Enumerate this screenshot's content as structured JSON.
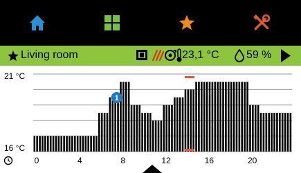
{
  "nav": {
    "items": [
      {
        "name": "home",
        "icon": "home-icon",
        "color": "#2a8fd4"
      },
      {
        "name": "grid",
        "icon": "grid-icon",
        "color": "#77c043"
      },
      {
        "name": "favorites",
        "icon": "star-icon",
        "color": "#f08a1f"
      },
      {
        "name": "settings",
        "icon": "tools-icon",
        "color": "#e35a2e"
      }
    ]
  },
  "status": {
    "room": "Living room",
    "temperature": "23,1 °C",
    "humidity": "59 %",
    "icons": [
      "window-icon",
      "heating-icon",
      "cycle-mode-icon",
      "thermometer-icon",
      "droplet-icon",
      "play-arrow-icon"
    ],
    "accent_color": "#8dc53e"
  },
  "chart_data": {
    "type": "bar",
    "y_top_label": "21 °C",
    "y_bottom_label": "16 °C",
    "ylim": [
      16,
      21
    ],
    "xlim": [
      0,
      24
    ],
    "x_ticks": [
      "0",
      "4",
      "8",
      "12",
      "16",
      "20"
    ],
    "x_tick_values": [
      0,
      4,
      8,
      12,
      16,
      20
    ],
    "marker_label": "1",
    "marker_hour": 8,
    "current_hour": 14.5,
    "bar_color": "#000000",
    "current_marker_color": "#e35a2e",
    "values": [
      17,
      17,
      17,
      17,
      17,
      17,
      17,
      17,
      17,
      17,
      17,
      17,
      17,
      17,
      17,
      17,
      17,
      17,
      17,
      17,
      17,
      17,
      17,
      17,
      18.5,
      18.5,
      18.5,
      18.5,
      19.5,
      19.5,
      19.5,
      19.5,
      20.5,
      20.5,
      20.5,
      20.5,
      19,
      19,
      19,
      19,
      18.5,
      18.5,
      18.5,
      18.5,
      18,
      18,
      18,
      18,
      19,
      19,
      19,
      19,
      19.5,
      19.5,
      19.5,
      19.5,
      20,
      20,
      20,
      20,
      20.5,
      20.5,
      20.5,
      20.5,
      20.5,
      20.5,
      20.5,
      20.5,
      20.5,
      20.5,
      20.5,
      20.5,
      20.5,
      20.5,
      20.5,
      20.5,
      20.5,
      20.5,
      20.5,
      20.5,
      19,
      19,
      19,
      19,
      18.5,
      18.5,
      18.5,
      18.5,
      18.5,
      18.5,
      18.5,
      18.5,
      18.5,
      18.5,
      18.5,
      18.5
    ]
  }
}
